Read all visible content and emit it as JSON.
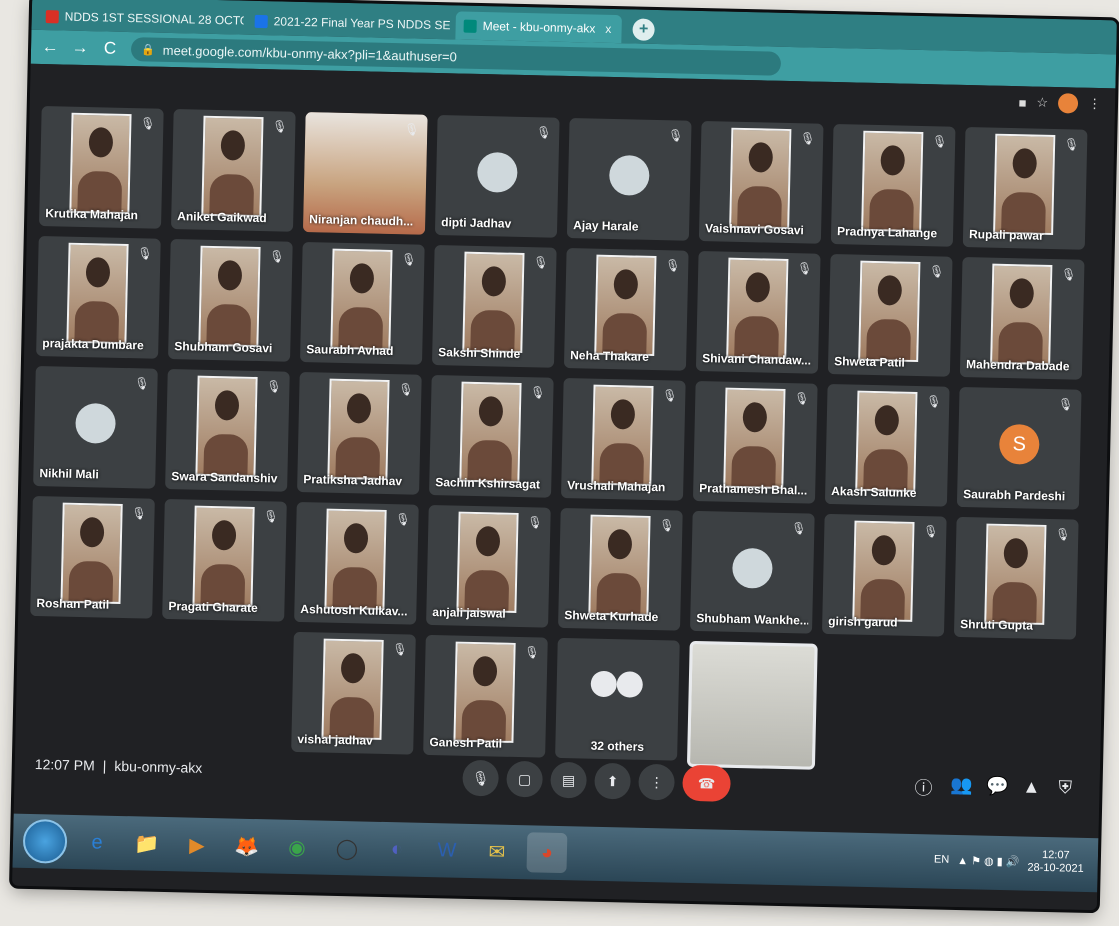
{
  "tabs": [
    {
      "label": "NDDS 1ST SESSIONAL 28 OCTO",
      "close": "x",
      "color": "#d93025"
    },
    {
      "label": "2021-22 Final Year PS NDDS SE",
      "close": "x",
      "color": "#1a73e8"
    },
    {
      "label": "Meet - kbu-onmy-akx",
      "close": "x",
      "color": "#00897b"
    }
  ],
  "newtab": "+",
  "nav": {
    "back": "←",
    "forward": "→",
    "reload": "C",
    "lock": "🔒"
  },
  "url": "meet.google.com/kbu-onmy-akx?pli=1&authuser=0",
  "participants": [
    {
      "name": "Krutika Mahajan",
      "col": 0,
      "row": 0
    },
    {
      "name": "Aniket Gaikwad",
      "col": 1,
      "row": 0
    },
    {
      "name": "Niranjan chaudh...",
      "col": 2,
      "row": 0,
      "kind": "video"
    },
    {
      "name": "dipti Jadhav",
      "col": 3,
      "row": 0,
      "kind": "avatar"
    },
    {
      "name": "Ajay Harale",
      "col": 4,
      "row": 0,
      "kind": "avatar"
    },
    {
      "name": "Vaishnavi Gosavi",
      "col": 5,
      "row": 0
    },
    {
      "name": "Pradnya Lahange",
      "col": 6,
      "row": 0
    },
    {
      "name": "Rupali pawar",
      "col": 7,
      "row": 0
    },
    {
      "name": "prajakta Dumbare",
      "col": 0,
      "row": 1
    },
    {
      "name": "Shubham Gosavi",
      "col": 1,
      "row": 1
    },
    {
      "name": "Saurabh Avhad",
      "col": 2,
      "row": 1
    },
    {
      "name": "Sakshi Shinde",
      "col": 3,
      "row": 1
    },
    {
      "name": "Neha Thakare",
      "col": 4,
      "row": 1
    },
    {
      "name": "Shivani Chandaw...",
      "col": 5,
      "row": 1
    },
    {
      "name": "Shweta Patil",
      "col": 6,
      "row": 1
    },
    {
      "name": "Mahendra Dabade",
      "col": 7,
      "row": 1
    },
    {
      "name": "Nikhil Mali",
      "col": 0,
      "row": 2,
      "kind": "avatar"
    },
    {
      "name": "Swara Sandanshiv",
      "col": 1,
      "row": 2
    },
    {
      "name": "Pratiksha Jadhav",
      "col": 2,
      "row": 2
    },
    {
      "name": "Sachin Kshirsagat",
      "col": 3,
      "row": 2
    },
    {
      "name": "Vrushali Mahajan",
      "col": 4,
      "row": 2
    },
    {
      "name": "Prathamesh Bhal...",
      "col": 5,
      "row": 2
    },
    {
      "name": "Akash Salunke",
      "col": 6,
      "row": 2
    },
    {
      "name": "Saurabh Pardeshi",
      "col": 7,
      "row": 2,
      "kind": "avatar",
      "letter": "S",
      "color": "#e8833a"
    },
    {
      "name": "Roshan Patil",
      "col": 0,
      "row": 3
    },
    {
      "name": "Pragati Gharate",
      "col": 1,
      "row": 3
    },
    {
      "name": "Ashutosh Kulkav...",
      "col": 2,
      "row": 3
    },
    {
      "name": "anjali jaiswal",
      "col": 3,
      "row": 3
    },
    {
      "name": "Shweta Kurhade",
      "col": 4,
      "row": 3
    },
    {
      "name": "Shubham Wankhe...",
      "col": 5,
      "row": 3,
      "kind": "avatar"
    },
    {
      "name": "girish garud",
      "col": 6,
      "row": 3
    },
    {
      "name": "Shruti Gupta",
      "col": 7,
      "row": 3
    },
    {
      "name": "vishal jadhav",
      "col": 2,
      "row": 4
    },
    {
      "name": "Ganesh Patil",
      "col": 3,
      "row": 4
    },
    {
      "name": "32 others",
      "col": 4,
      "row": 4,
      "kind": "others"
    },
    {
      "name": "",
      "col": 5,
      "row": 4,
      "kind": "self"
    }
  ],
  "mic_icon": "🎙",
  "meeting": {
    "time": "12:07 PM",
    "separator": "|",
    "code": "kbu-onmy-akx"
  },
  "controls": [
    {
      "id": "mic",
      "glyph": "🎙"
    },
    {
      "id": "camera",
      "glyph": "▢"
    },
    {
      "id": "captions",
      "glyph": "▤"
    },
    {
      "id": "present",
      "glyph": "⬆"
    },
    {
      "id": "more",
      "glyph": "⋮"
    },
    {
      "id": "end",
      "glyph": "☎"
    }
  ],
  "right_controls": [
    "ⓘ",
    "👥",
    "💬",
    "▲",
    "⛨"
  ],
  "taskbar_icons": [
    "e",
    "📁",
    "▶",
    "🦊",
    "◉",
    "◯",
    "◐",
    "W",
    "✉",
    "◕"
  ],
  "tray": {
    "lang": "EN",
    "time": "12:07",
    "date": "28-10-2021"
  }
}
